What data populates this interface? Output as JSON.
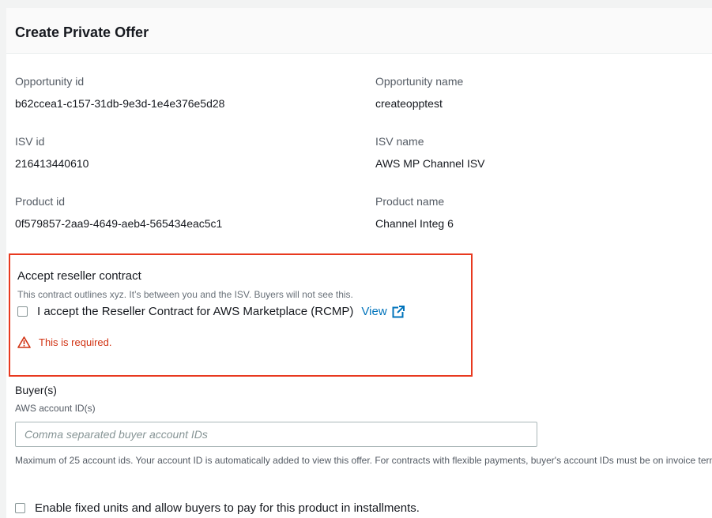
{
  "header": {
    "title": "Create Private Offer"
  },
  "details": {
    "opportunity_id": {
      "label": "Opportunity id",
      "value": "b62ccea1-c157-31db-9e3d-1e4e376e5d28"
    },
    "opportunity_name": {
      "label": "Opportunity name",
      "value": "createopptest"
    },
    "isv_id": {
      "label": "ISV id",
      "value": "216413440610"
    },
    "isv_name": {
      "label": "ISV name",
      "value": "AWS MP Channel ISV"
    },
    "product_id": {
      "label": "Product id",
      "value": "0f579857-2aa9-4649-aeb4-565434eac5c1"
    },
    "product_name": {
      "label": "Product name",
      "value": "Channel Integ 6"
    }
  },
  "contract": {
    "title": "Accept reseller contract",
    "description": "This contract outlines xyz. It’s between you and the ISV. Buyers will not see this.",
    "checkbox_label": "I accept the Reseller Contract for AWS Marketplace (RCMP)",
    "view_link": "View",
    "error": "This is required.",
    "highlight_color": "#e8391f",
    "link_color": "#0073bb",
    "error_color": "#d13212"
  },
  "buyers": {
    "title": "Buyer(s)",
    "field_label": "AWS account ID(s)",
    "placeholder": "Comma separated buyer account IDs",
    "help": "Maximum of 25 account ids. Your account ID is automatically added to view this offer. For contracts with flexible payments, buyer's account IDs must be on invoice terms."
  },
  "installments": {
    "checkbox_label": "Enable fixed units and allow buyers to pay for this product in installments."
  },
  "icons": [
    "external-link-icon",
    "warning-icon"
  ]
}
